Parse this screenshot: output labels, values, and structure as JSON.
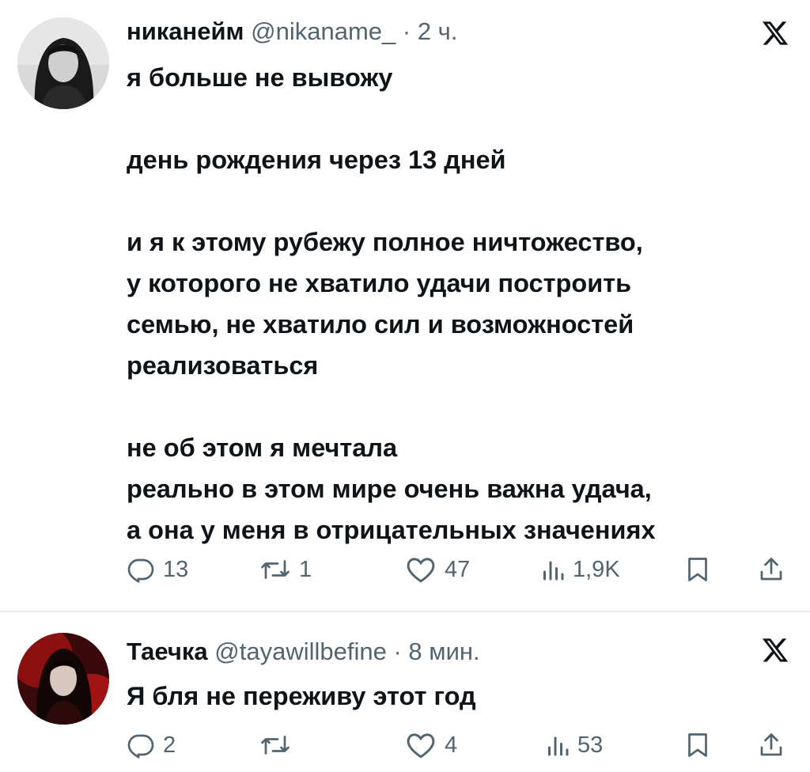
{
  "tweets": [
    {
      "author": {
        "display_name": "никанейм",
        "handle": "@nikaname_",
        "separator": "·",
        "time": "2 ч."
      },
      "platform_icon": "x-logo-icon",
      "text_lines": [
        "я больше не вывожу",
        "",
        "день рождения через 13 дней",
        "",
        "и я к этому рубежу полное ничтожество,",
        "у которого не хватило удачи построить",
        "семью, не хватило сил и возможностей",
        "реализоваться",
        "",
        "не об этом я мечтала",
        "реально в этом мире очень важна удача,",
        "а она у меня в отрицательных значениях"
      ],
      "actions": {
        "replies": "13",
        "retweets": "1",
        "likes": "47",
        "views": "1,9K"
      }
    },
    {
      "author": {
        "display_name": "Таечка",
        "handle": "@tayawillbefine",
        "separator": "·",
        "time": "8 мин."
      },
      "platform_icon": "x-logo-icon",
      "text_lines": [
        "Я бля не переживу этот год"
      ],
      "actions": {
        "replies": "2",
        "retweets": "",
        "likes": "4",
        "views": "53"
      }
    }
  ],
  "colors": {
    "text": "#0f1419",
    "secondary": "#536471",
    "divider": "#e8eaed"
  }
}
